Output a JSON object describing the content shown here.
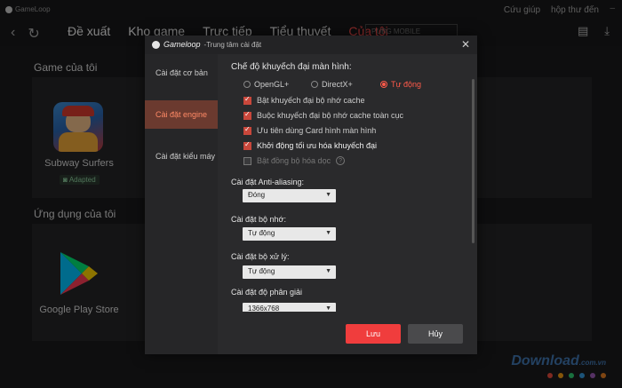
{
  "window": {
    "app_name": "GameLoop",
    "links": [
      "Cứu giúp",
      "hộp thư đến"
    ]
  },
  "nav": {
    "tabs": [
      "Đề xuất",
      "Kho game",
      "Trực tiếp",
      "Tiểu thuyết",
      "Của tôi"
    ],
    "active_tab": 4,
    "search_placeholder": "PUBG MOBILE"
  },
  "sections": {
    "my_games_title": "Game của tôi",
    "my_apps_title": "Ứng dụng của tôi"
  },
  "games": [
    {
      "name": "Subway Surfers",
      "badge": "Adapted"
    }
  ],
  "apps": [
    {
      "name": "Google Play Store"
    }
  ],
  "dialog": {
    "brand": "Gameloop",
    "subtitle": "-Trung tâm cài đặt",
    "sidebar": [
      "Cài đặt cơ bản",
      "Cài đặt engine",
      "Cài đặt kiểu máy"
    ],
    "active_sidebar": 1,
    "render_mode_label": "Chế độ khuyếch đại màn hình:",
    "render_options": [
      "OpenGL+",
      "DirectX+",
      "Tự động"
    ],
    "selected_render": "Tự động",
    "checkboxes": [
      {
        "label": "Bật khuyếch đại bộ nhớ cache",
        "checked": true
      },
      {
        "label": "Buộc khuyếch đại bộ nhớ cache toàn cục",
        "checked": true
      },
      {
        "label": "Ưu tiên dùng Card hình màn hình",
        "checked": true
      },
      {
        "label": "Khởi động tối ưu hóa khuyếch đại",
        "checked": true
      },
      {
        "label": "Bật đồng bộ hóa dọc",
        "checked": false
      }
    ],
    "antialias_label": "Cài đặt Anti-aliasing:",
    "antialias_value": "Đóng",
    "memory_label": "Cài đặt bộ nhớ:",
    "memory_value": "Tự động",
    "cpu_label": "Cài đặt bộ xử lý:",
    "cpu_value": "Tự động",
    "resolution_label": "Cài đặt độ phân giải",
    "resolution_value": "1366x768",
    "save_label": "Lưu",
    "cancel_label": "Hủy"
  },
  "watermark": {
    "text": "Download",
    "suffix": ".com.vn",
    "dot_colors": [
      "#e74c3c",
      "#f39c12",
      "#2ecc71",
      "#3498db",
      "#9b59b6",
      "#e67e22"
    ]
  },
  "colors": {
    "accent": "#ff4d4d",
    "save_button": "#f03d3d",
    "sidebar_active": "#6b3a2f"
  }
}
